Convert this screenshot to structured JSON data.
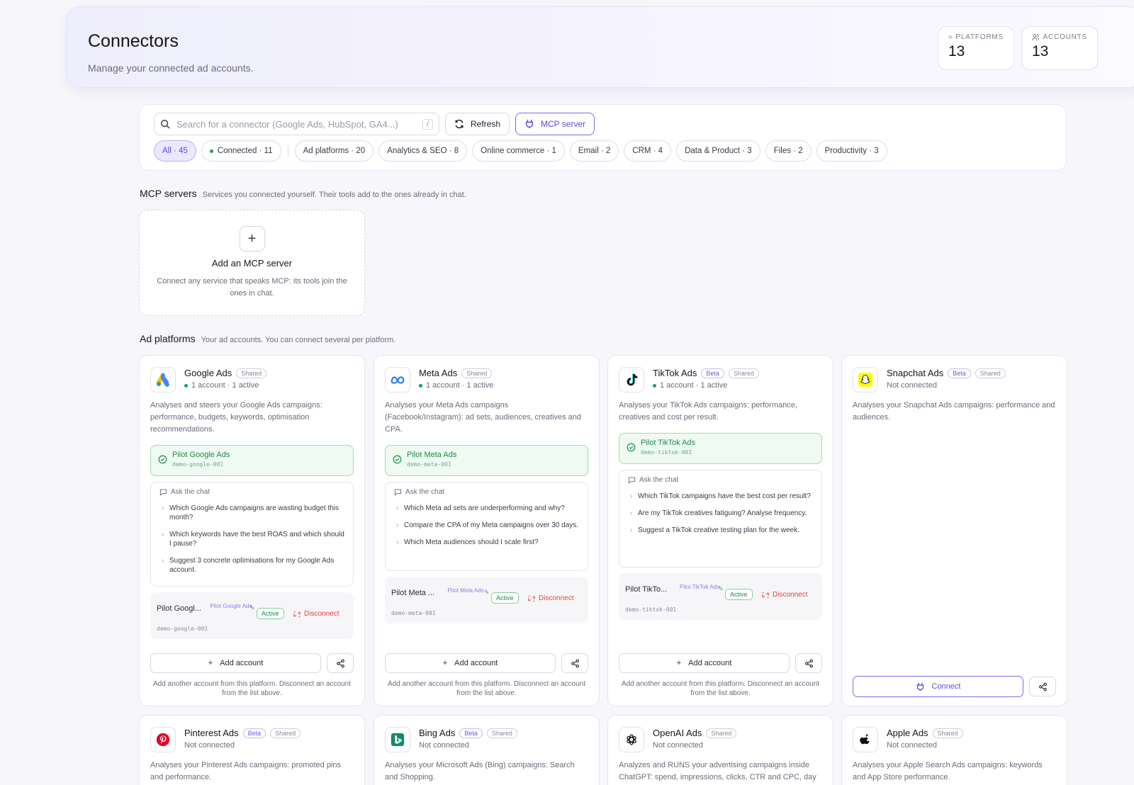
{
  "header": {
    "title": "Connectors",
    "subtitle": "Manage your connected ad accounts.",
    "stats": [
      {
        "label": "PLATFORMS",
        "value": "13",
        "icon": "plug-icon"
      },
      {
        "label": "ACCOUNTS",
        "value": "13",
        "icon": "users-icon"
      }
    ]
  },
  "toolbar": {
    "search_placeholder": "Search for a connector (Google Ads, HubSpot, GA4...)",
    "search_shortcut": "/",
    "refresh_label": "Refresh",
    "mcp_label": "MCP server",
    "filters": [
      {
        "label": "All · 45",
        "active": true
      },
      {
        "label": "Connected · 11",
        "dot": true
      },
      {
        "label": "Ad platforms · 20"
      },
      {
        "label": "Analytics & SEO · 8"
      },
      {
        "label": "Online commerce · 1"
      },
      {
        "label": "Email · 2"
      },
      {
        "label": "CRM · 4"
      },
      {
        "label": "Data & Product · 3"
      },
      {
        "label": "Files · 2"
      },
      {
        "label": "Productivity · 3"
      }
    ]
  },
  "mcp_section": {
    "title": "MCP servers",
    "description": "Services you connected yourself. Their tools add to the ones already in chat.",
    "add_title": "Add an MCP server",
    "add_description": "Connect any service that speaks MCP: its tools join the ones in chat."
  },
  "ad_section": {
    "title": "Ad platforms",
    "description": "Your ad accounts. You can connect several per platform."
  },
  "common": {
    "shared": "Shared",
    "beta": "Beta",
    "ask_title": "Ask the chat",
    "active": "Active",
    "disconnect": "Disconnect",
    "add_account": "Add account",
    "add_hint": "Add another account from this platform. Disconnect an account from the list above.",
    "connect": "Connect",
    "not_connected": "Not connected"
  },
  "cards": [
    {
      "name": "Google Ads",
      "status": "1 account · 1 active",
      "description": "Analyses and steers your Google Ads campaigns: performance, budgets, keywords, optimisation recommendations.",
      "pilot_name": "Pilot Google Ads",
      "pilot_id": "demo-google-001",
      "questions": [
        "Which Google Ads campaigns are wasting budget this month?",
        "Which keywords have the best ROAS and which should I pause?",
        "Suggest 3 concrete optimisations for my Google Ads account."
      ],
      "account_name": "Pilot Googl...",
      "account_label": "Pilot Google Ads",
      "account_id": "demo-google-001"
    },
    {
      "name": "Meta Ads",
      "status": "1 account · 1 active",
      "description": "Analyses your Meta Ads campaigns (Facebook/Instagram): ad sets, audiences, creatives and CPA.",
      "pilot_name": "Pilot Meta Ads",
      "pilot_id": "demo-meta-001",
      "questions": [
        "Which Meta ad sets are underperforming and why?",
        "Compare the CPA of my Meta campaigns over 30 days.",
        "Which Meta audiences should I scale first?"
      ],
      "account_name": "Pilot Meta ...",
      "account_label": "Pilot Meta Ads",
      "account_id": "demo-meta-001"
    },
    {
      "name": "TikTok Ads",
      "status": "1 account · 1 active",
      "description": "Analyses your TikTok Ads campaigns: performance, creatives and cost per result.",
      "pilot_name": "Pilot TikTok Ads",
      "pilot_id": "demo-tiktok-001",
      "questions": [
        "Which TikTok campaigns have the best cost per result?",
        "Are my TikTok creatives fatiguing? Analyse frequency.",
        "Suggest a TikTok creative testing plan for the week."
      ],
      "account_name": "Pilot TikTo...",
      "account_label": "Pilot TikTok Ads",
      "account_id": "demo-tiktok-001"
    },
    {
      "name": "Snapchat Ads",
      "description": "Analyses your Snapchat Ads campaigns: performance and audiences."
    },
    {
      "name": "Pinterest Ads",
      "description": "Analyses your Pinterest Ads campaigns: promoted pins and performance."
    },
    {
      "name": "Bing Ads",
      "description": "Analyses your Microsoft Ads (Bing) campaigns: Search and Shopping."
    },
    {
      "name": "OpenAI Ads",
      "description": "Analyzes and RUNS your advertising campaigns inside ChatGPT: spend, impressions, clicks, CTR and CPC, day"
    },
    {
      "name": "Apple Ads",
      "description": "Analyses your Apple Search Ads campaigns: keywords and App Store performance."
    }
  ],
  "colors": {
    "accent": "#5b4bdc",
    "success": "#1f8a4a",
    "danger": "#e0453a"
  }
}
